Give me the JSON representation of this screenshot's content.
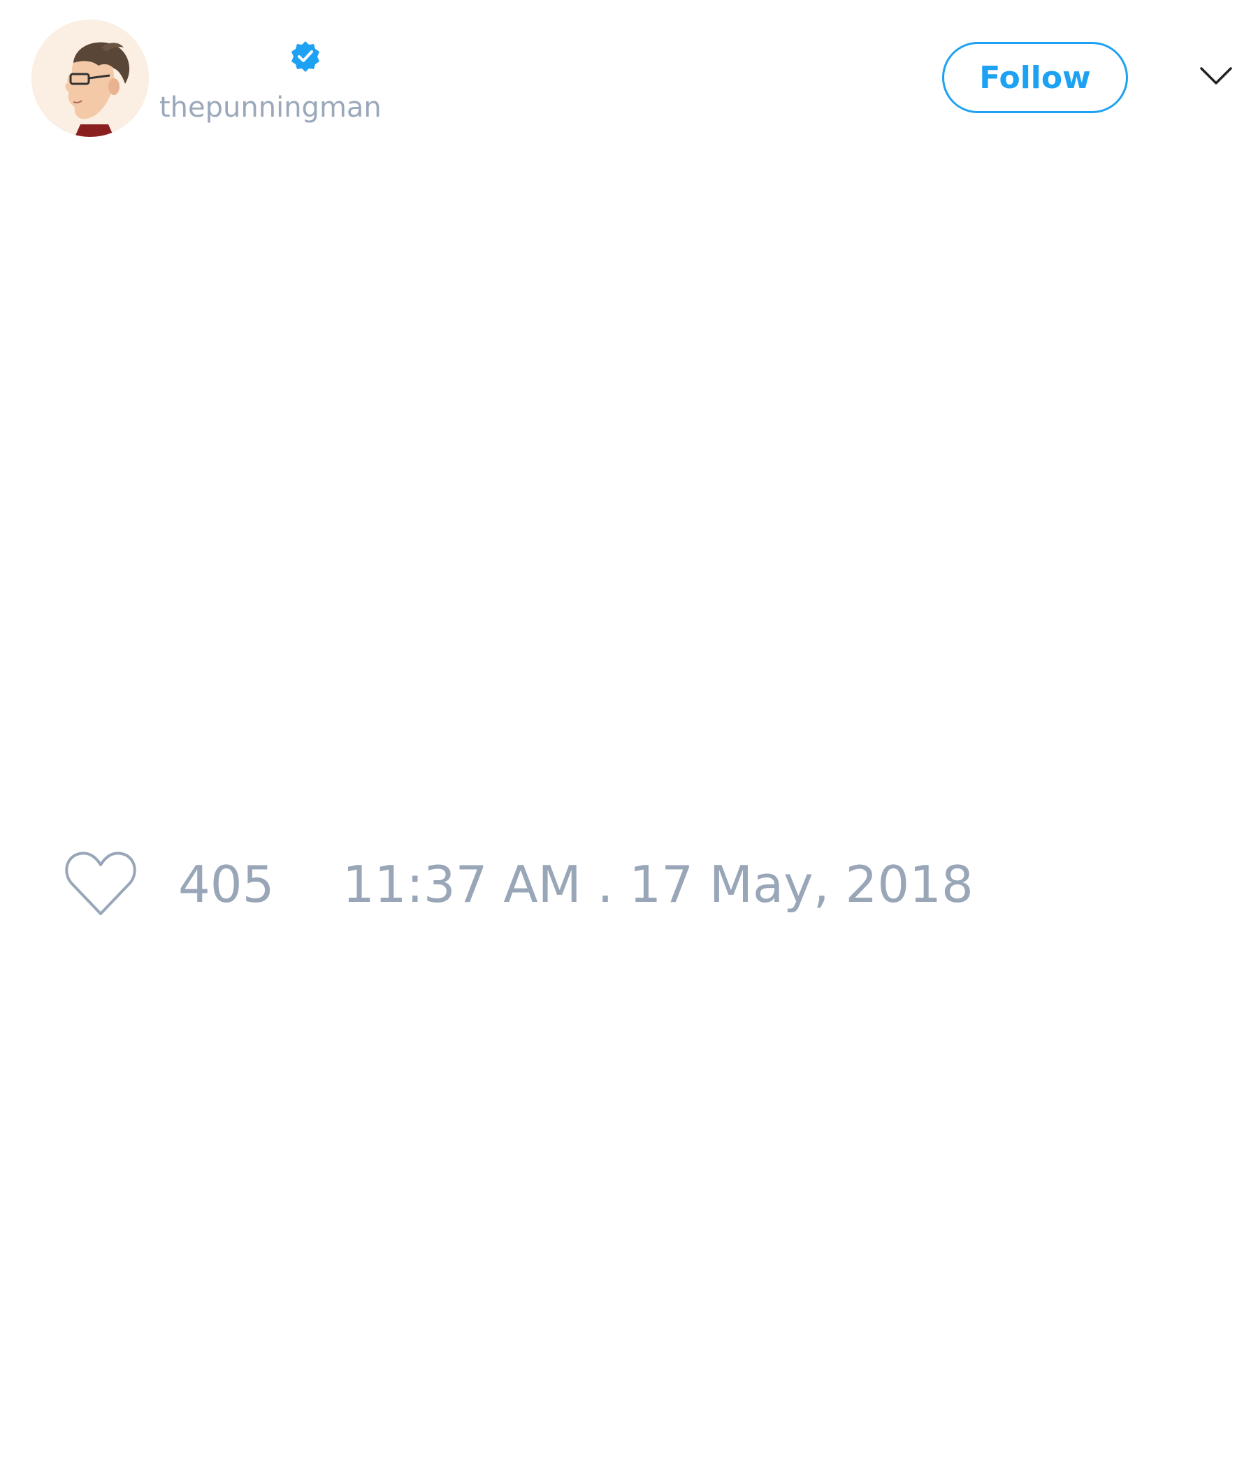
{
  "tweet": {
    "author": {
      "handle": "thepunningman",
      "verified": true,
      "avatar_icon": "cartoon-man-profile-avatar"
    },
    "follow_label": "Follow",
    "menu_icon": "chevron-down-icon",
    "likes": "405",
    "timestamp": "11:37 AM . 17 May, 2018",
    "colors": {
      "accent": "#1da1f2",
      "muted": "#98a6b8",
      "background": "#ffffff"
    }
  }
}
